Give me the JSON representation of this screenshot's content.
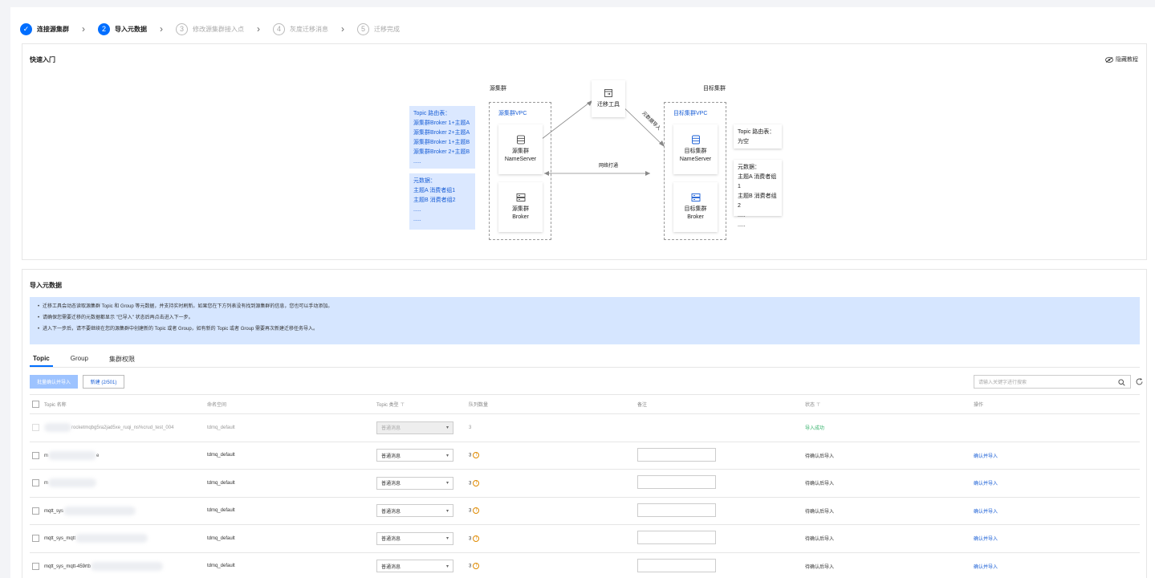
{
  "stepper": {
    "steps": [
      {
        "num": "✓",
        "label": "连接源集群",
        "state": "done"
      },
      {
        "num": "2",
        "label": "导入元数据",
        "state": "active"
      },
      {
        "num": "3",
        "label": "修改源集群接入点",
        "state": "todo"
      },
      {
        "num": "4",
        "label": "灰度迁移消息",
        "state": "todo"
      },
      {
        "num": "5",
        "label": "迁移完成",
        "state": "todo"
      }
    ],
    "arrow": "›"
  },
  "quick_start": {
    "title": "快速入门",
    "hide_label": "隐藏教程",
    "diagram": {
      "source_cluster_label": "源集群",
      "target_cluster_label": "目标集群",
      "source_vpc_label": "源集群VPC",
      "target_vpc_label": "目标集群VPC",
      "tool_label": "迁移工具",
      "network_label": "网络打通",
      "import_label": "元数据导入",
      "source_nameserver": [
        "源集群",
        "NameServer"
      ],
      "source_broker": [
        "源集群",
        "Broker"
      ],
      "target_nameserver": [
        "目标集群",
        "NameServer"
      ],
      "target_broker": [
        "目标集群",
        "Broker"
      ],
      "source_route_table": [
        "Topic 路由表：",
        "源集群Broker 1+主题A",
        "源集群Broker 2+主题A",
        "源集群Broker 1+主题B",
        "源集群Broker 2+主题B",
        "....."
      ],
      "source_metadata": [
        "元数据：",
        "主题A  消费者组1",
        "主题B  消费者组2",
        ".....",
        "....."
      ],
      "target_route_table": [
        "Topic 路由表：",
        "为空"
      ],
      "target_metadata": [
        "元数据：",
        "主题A 消费者组1",
        "主题B 消费者组2",
        ".....",
        "....."
      ]
    }
  },
  "import_section": {
    "title": "导入元数据",
    "notices": [
      "迁移工具会动态读取源集群 Topic 和 Group 等元数据，并支持实时刷新。如果您在下方列表没有找到源集群的信息，您也可以手动添加。",
      "请确保您需要迁移的元数据都显示 \"已导入\" 状态后再点击进入下一步。",
      "进入下一步后，请不要继续在您的源集群中创建新的 Topic 或者 Group，如有新的 Topic 或者 Group 需要再次新建迁移任务导入。"
    ],
    "tabs": [
      "Topic",
      "Group",
      "集群权限"
    ],
    "active_tab": "Topic",
    "batch_button": "批量确认并导入",
    "new_button": "新建 (2/501)",
    "search_placeholder": "请输入关键字进行搜索",
    "columns": [
      "Topic 名称",
      "命名空间",
      "Topic 类型",
      "队列数量",
      "备注",
      "状态",
      "操作"
    ],
    "rows": [
      {
        "name": "rocketmqbg5ra2jad5xe_ruqi_ns%crud_test_004",
        "namespace": "tdmq_default",
        "type": "普通消息",
        "queues": "3",
        "warn": false,
        "status": "导入成功",
        "action": "",
        "disabled": true,
        "prefix": ""
      },
      {
        "name": "e",
        "namespace": "tdmq_default",
        "type": "普通消息",
        "queues": "3",
        "warn": true,
        "status": "待确认后导入",
        "action": "确认并导入",
        "disabled": false,
        "prefix": "m"
      },
      {
        "name": "",
        "namespace": "tdmq_default",
        "type": "普通消息",
        "queues": "3",
        "warn": true,
        "status": "待确认后导入",
        "action": "确认并导入",
        "disabled": false,
        "prefix": "m"
      },
      {
        "name": "",
        "namespace": "tdmq_default",
        "type": "普通消息",
        "queues": "3",
        "warn": true,
        "status": "待确认后导入",
        "action": "确认并导入",
        "disabled": false,
        "prefix": "mqtt_sys"
      },
      {
        "name": "",
        "namespace": "tdmq_default",
        "type": "普通消息",
        "queues": "3",
        "warn": true,
        "status": "待确认后导入",
        "action": "确认并导入",
        "disabled": false,
        "prefix": "mqtt_sys_mqtt"
      },
      {
        "name": "",
        "namespace": "tdmq_default",
        "type": "普通消息",
        "queues": "3",
        "warn": true,
        "status": "待确认后导入",
        "action": "确认并导入",
        "disabled": false,
        "prefix": "mqtt_sys_mqtt-459rtb"
      }
    ],
    "warn_glyph": "!",
    "caret_glyph": "▾",
    "filter_glyph": "⊤"
  }
}
